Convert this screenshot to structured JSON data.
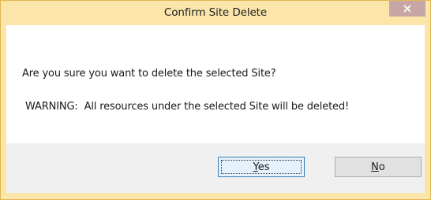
{
  "dialog": {
    "title": "Confirm Site Delete",
    "close_icon": "close-icon",
    "question": "Are you sure you want to delete the selected Site?",
    "warning": "WARNING:  All resources under the selected Site will be deleted!",
    "buttons": {
      "yes_label": "Yes",
      "no_label": "No"
    }
  },
  "colors": {
    "titlebar": "#fbe5a9",
    "close_button": "#c7a6a6",
    "client_background": "#f0f0f0",
    "content_background": "#ffffff",
    "default_button_border": "#3c7fb1"
  }
}
